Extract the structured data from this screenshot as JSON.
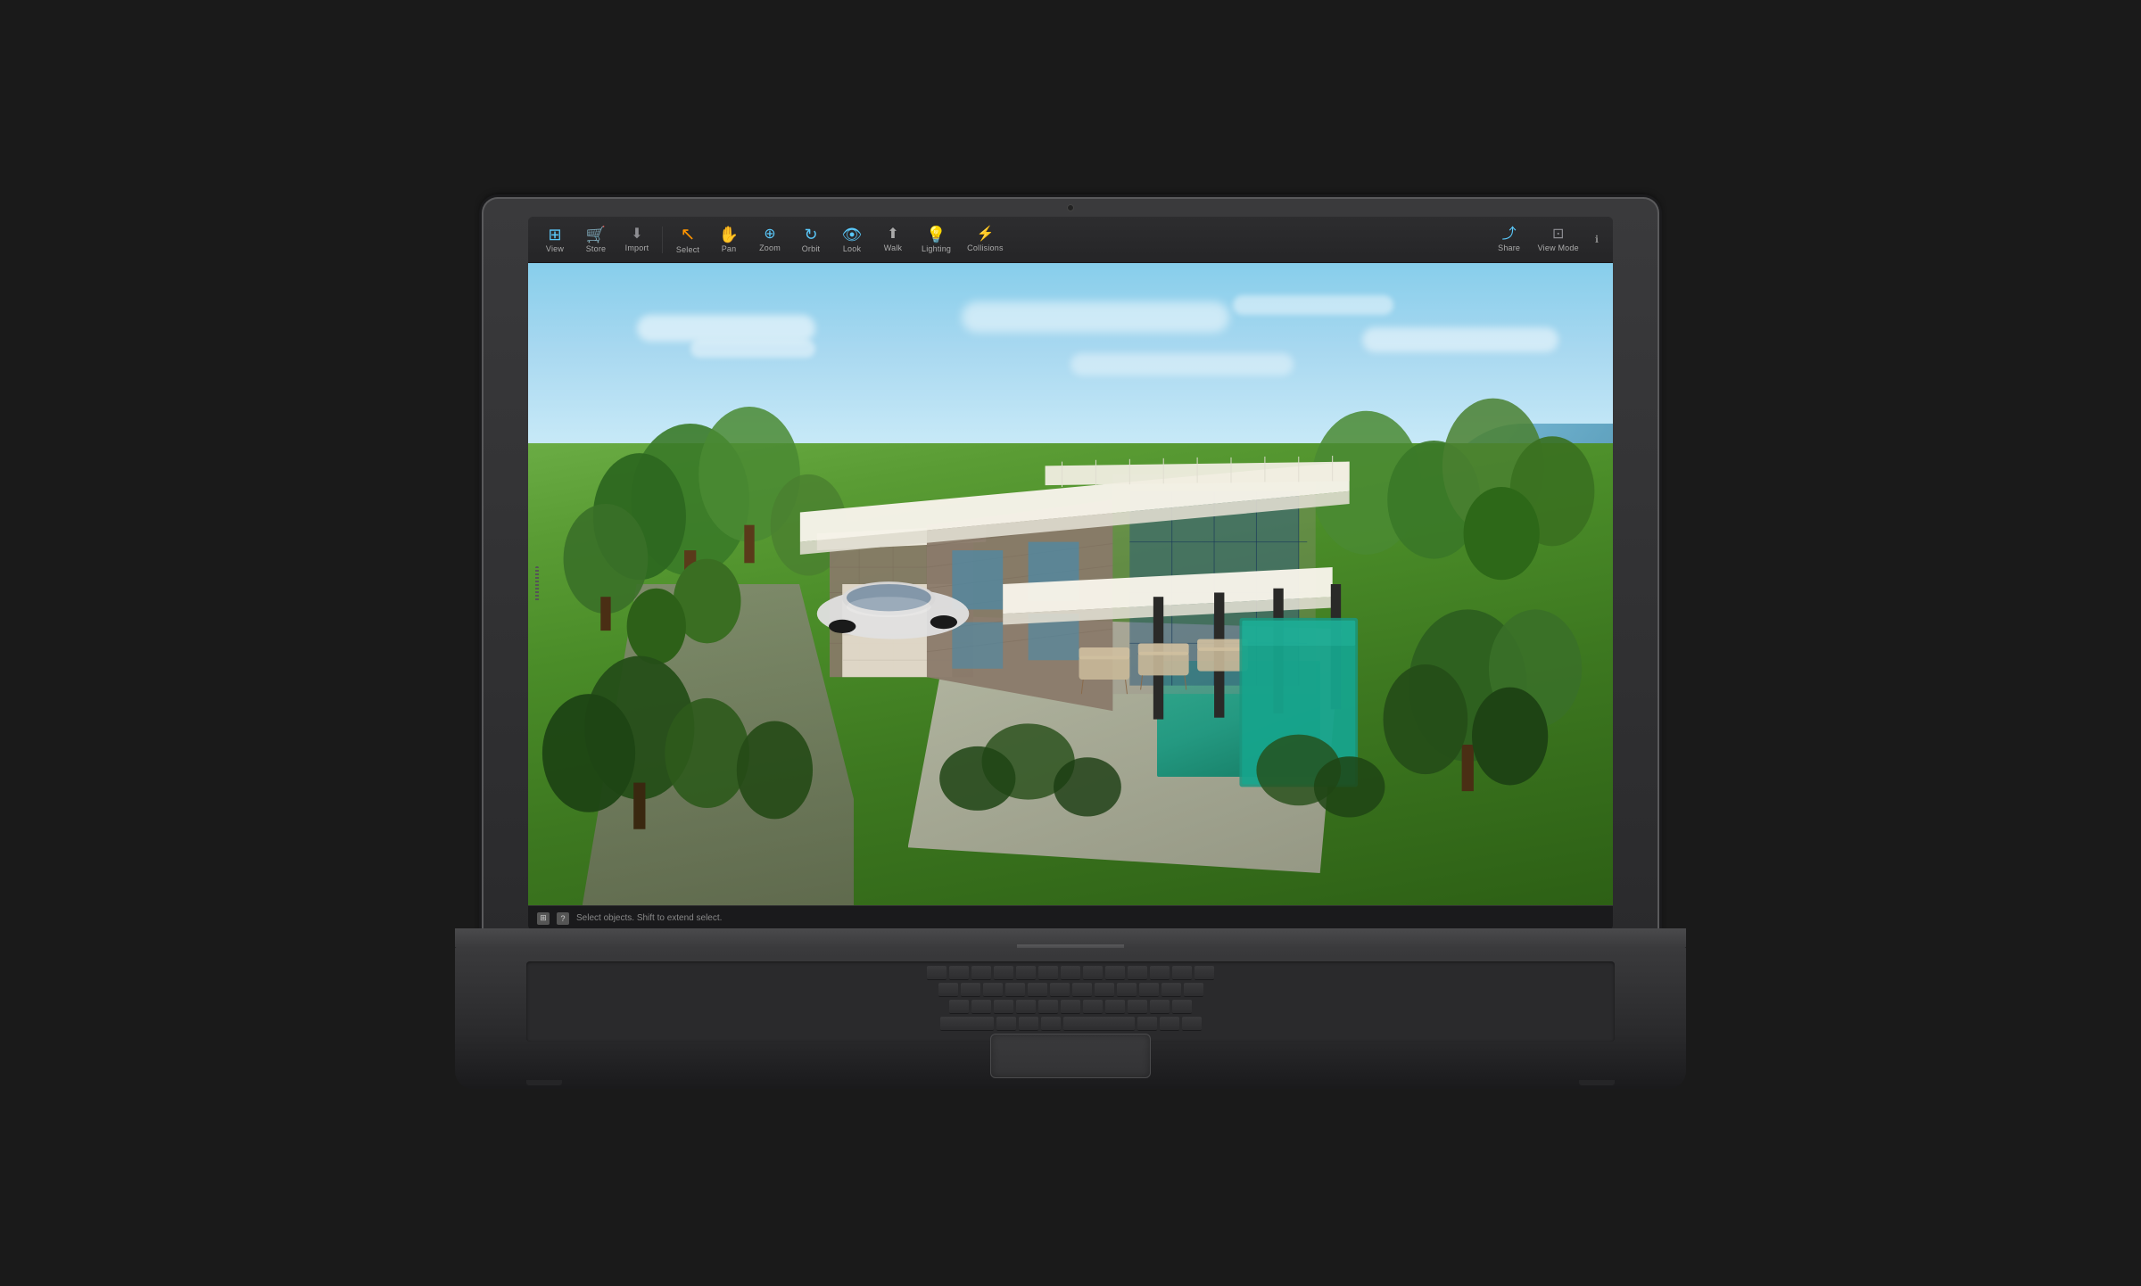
{
  "toolbar": {
    "left_items": [
      {
        "id": "view",
        "label": "View",
        "icon": "⊞",
        "icon_class": "icon-view"
      },
      {
        "id": "store",
        "label": "Store",
        "icon": "🛒",
        "icon_class": "icon-store"
      },
      {
        "id": "import",
        "label": "Import",
        "icon": "⬇",
        "icon_class": "icon-import"
      },
      {
        "id": "select",
        "label": "Select",
        "icon": "↖",
        "icon_class": "icon-select"
      },
      {
        "id": "pan",
        "label": "Pan",
        "icon": "✋",
        "icon_class": "icon-pan"
      },
      {
        "id": "zoom",
        "label": "Zoom",
        "icon": "🔍",
        "icon_class": "icon-zoom"
      },
      {
        "id": "orbit",
        "label": "Orbit",
        "icon": "⟳",
        "icon_class": "icon-orbit"
      },
      {
        "id": "look",
        "label": "Look",
        "icon": "👁",
        "icon_class": "icon-look"
      },
      {
        "id": "walk",
        "label": "Walk",
        "icon": "⬆",
        "icon_class": "icon-walk"
      },
      {
        "id": "lighting",
        "label": "Lighting",
        "icon": "💡",
        "icon_class": "icon-lighting"
      },
      {
        "id": "collisions",
        "label": "Collisions",
        "icon": "⚡",
        "icon_class": "icon-collisions"
      }
    ],
    "right_items": [
      {
        "id": "share",
        "label": "Share",
        "icon": "⤴",
        "icon_class": "icon-share"
      },
      {
        "id": "viewmode",
        "label": "View Mode",
        "icon": "⊡",
        "icon_class": "icon-viewmode"
      }
    ],
    "info_icon": "ℹ"
  },
  "status_bar": {
    "icons": [
      "⊞",
      "?"
    ],
    "text": "Select objects. Shift to extend select."
  }
}
